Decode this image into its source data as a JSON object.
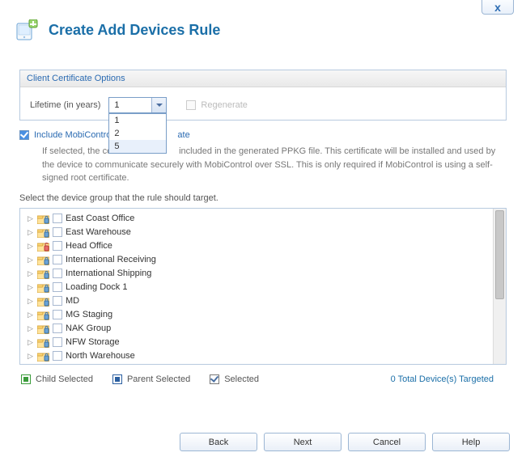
{
  "header": {
    "title": "Create Add Devices Rule"
  },
  "cert_section": {
    "title": "Client Certificate Options",
    "lifetime_label": "Lifetime (in years)",
    "selected": "1",
    "options": [
      "1",
      "2",
      "5"
    ],
    "regenerate_label": "Regenerate"
  },
  "include": {
    "label_prefix": "Include MobiContro",
    "label_suffix": "ate",
    "explain_prefix": "If selected, the cert",
    "explain_rest": "included in the generated PPKG file. This certificate will be installed and used by the device to communicate securely with MobiControl over SSL. This is only required if MobiControl is using a self-signed root certificate."
  },
  "tree": {
    "prompt": "Select the device group that the rule should target.",
    "items": [
      {
        "label": "East Coast Office",
        "locked": true
      },
      {
        "label": "East Warehouse",
        "locked": true
      },
      {
        "label": "Head Office",
        "locked": false
      },
      {
        "label": "International Receiving",
        "locked": true
      },
      {
        "label": "International Shipping",
        "locked": true
      },
      {
        "label": "Loading Dock 1",
        "locked": true
      },
      {
        "label": "MD",
        "locked": true
      },
      {
        "label": "MG Staging",
        "locked": true
      },
      {
        "label": "NAK Group",
        "locked": true
      },
      {
        "label": "NFW Storage",
        "locked": true
      },
      {
        "label": "North Warehouse",
        "locked": true
      }
    ]
  },
  "legend": {
    "child": "Child Selected",
    "parent": "Parent Selected",
    "selected": "Selected",
    "targeted": "0 Total Device(s) Targeted"
  },
  "footer": {
    "back": "Back",
    "next": "Next",
    "cancel": "Cancel",
    "help": "Help"
  }
}
